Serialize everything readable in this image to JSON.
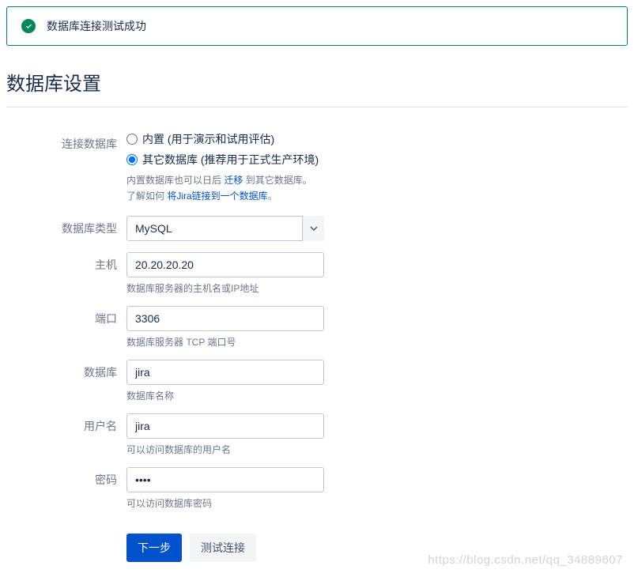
{
  "banner": {
    "message": "数据库连接测试成功"
  },
  "page_title": "数据库设置",
  "form": {
    "connect_db": {
      "label": "连接数据库",
      "option_builtin": "内置 (用于演示和试用评估)",
      "option_other": "其它数据库 (推荐用于正式生产环境)",
      "help_prefix": "内置数据库也可以日后 ",
      "help_link1": "迁移",
      "help_mid": " 到其它数据库。",
      "help_line2_prefix": "了解如何 ",
      "help_link2": "将Jira链接到一个数据库",
      "help_line2_suffix": "。"
    },
    "db_type": {
      "label": "数据库类型",
      "value": "MySQL"
    },
    "host": {
      "label": "主机",
      "value": "20.20.20.20",
      "help": "数据库服务器的主机名或IP地址"
    },
    "port": {
      "label": "端口",
      "value": "3306",
      "help": "数据库服务器 TCP 端口号"
    },
    "database": {
      "label": "数据库",
      "value": "jira",
      "help": "数据库名称"
    },
    "username": {
      "label": "用户名",
      "value": "jira",
      "help": "可以访问数据库的用户名"
    },
    "password": {
      "label": "密码",
      "value": "••••",
      "help": "可以访问数据库密码"
    }
  },
  "buttons": {
    "next": "下一步",
    "test": "测试连接"
  },
  "watermark": "https://blog.csdn.net/qq_34889607"
}
